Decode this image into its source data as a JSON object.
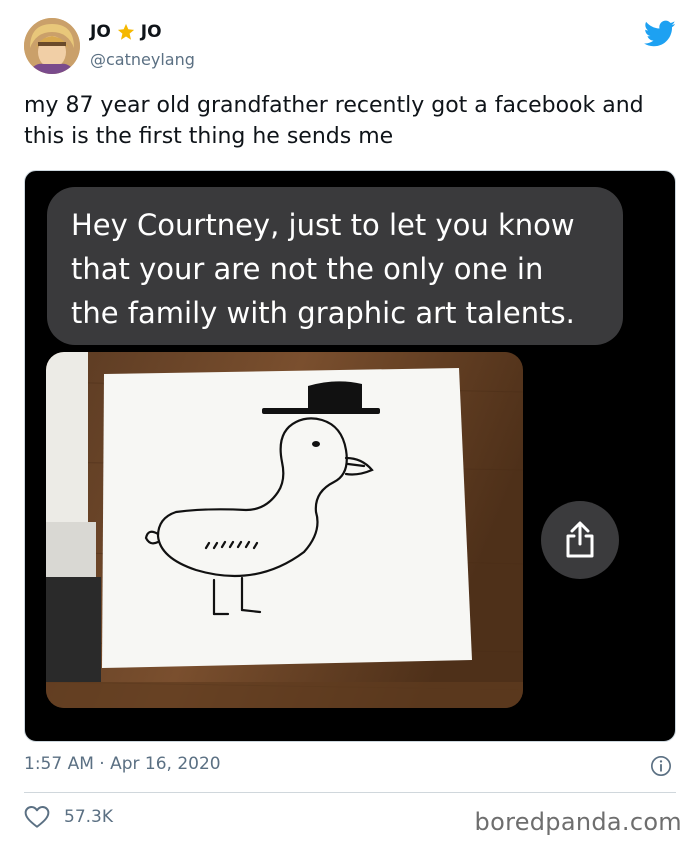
{
  "author": {
    "name_part1": "JO",
    "name_part2": "JO",
    "handle": "@catneylang"
  },
  "tweet": {
    "text": "my 87 year old grandfather recently got a facebook and this is the first thing he sends me"
  },
  "message": {
    "line1": "Hey Courtney, just to let you know",
    "line2": "that your are not the only one in",
    "line3": "the family with graphic art talents."
  },
  "meta": {
    "timestamp": "1:57 AM · Apr 16, 2020",
    "likes": "57.3K"
  },
  "watermark": "boredpanda.com",
  "icons": {
    "brand": "twitter-bird-icon",
    "star": "star-icon",
    "share": "share-icon",
    "info": "info-icon",
    "like": "heart-icon"
  },
  "colors": {
    "twitter_blue": "#1da1f2",
    "secondary_text": "#5b7083",
    "bubble": "#3a3a3c",
    "star": "#f5b800"
  }
}
